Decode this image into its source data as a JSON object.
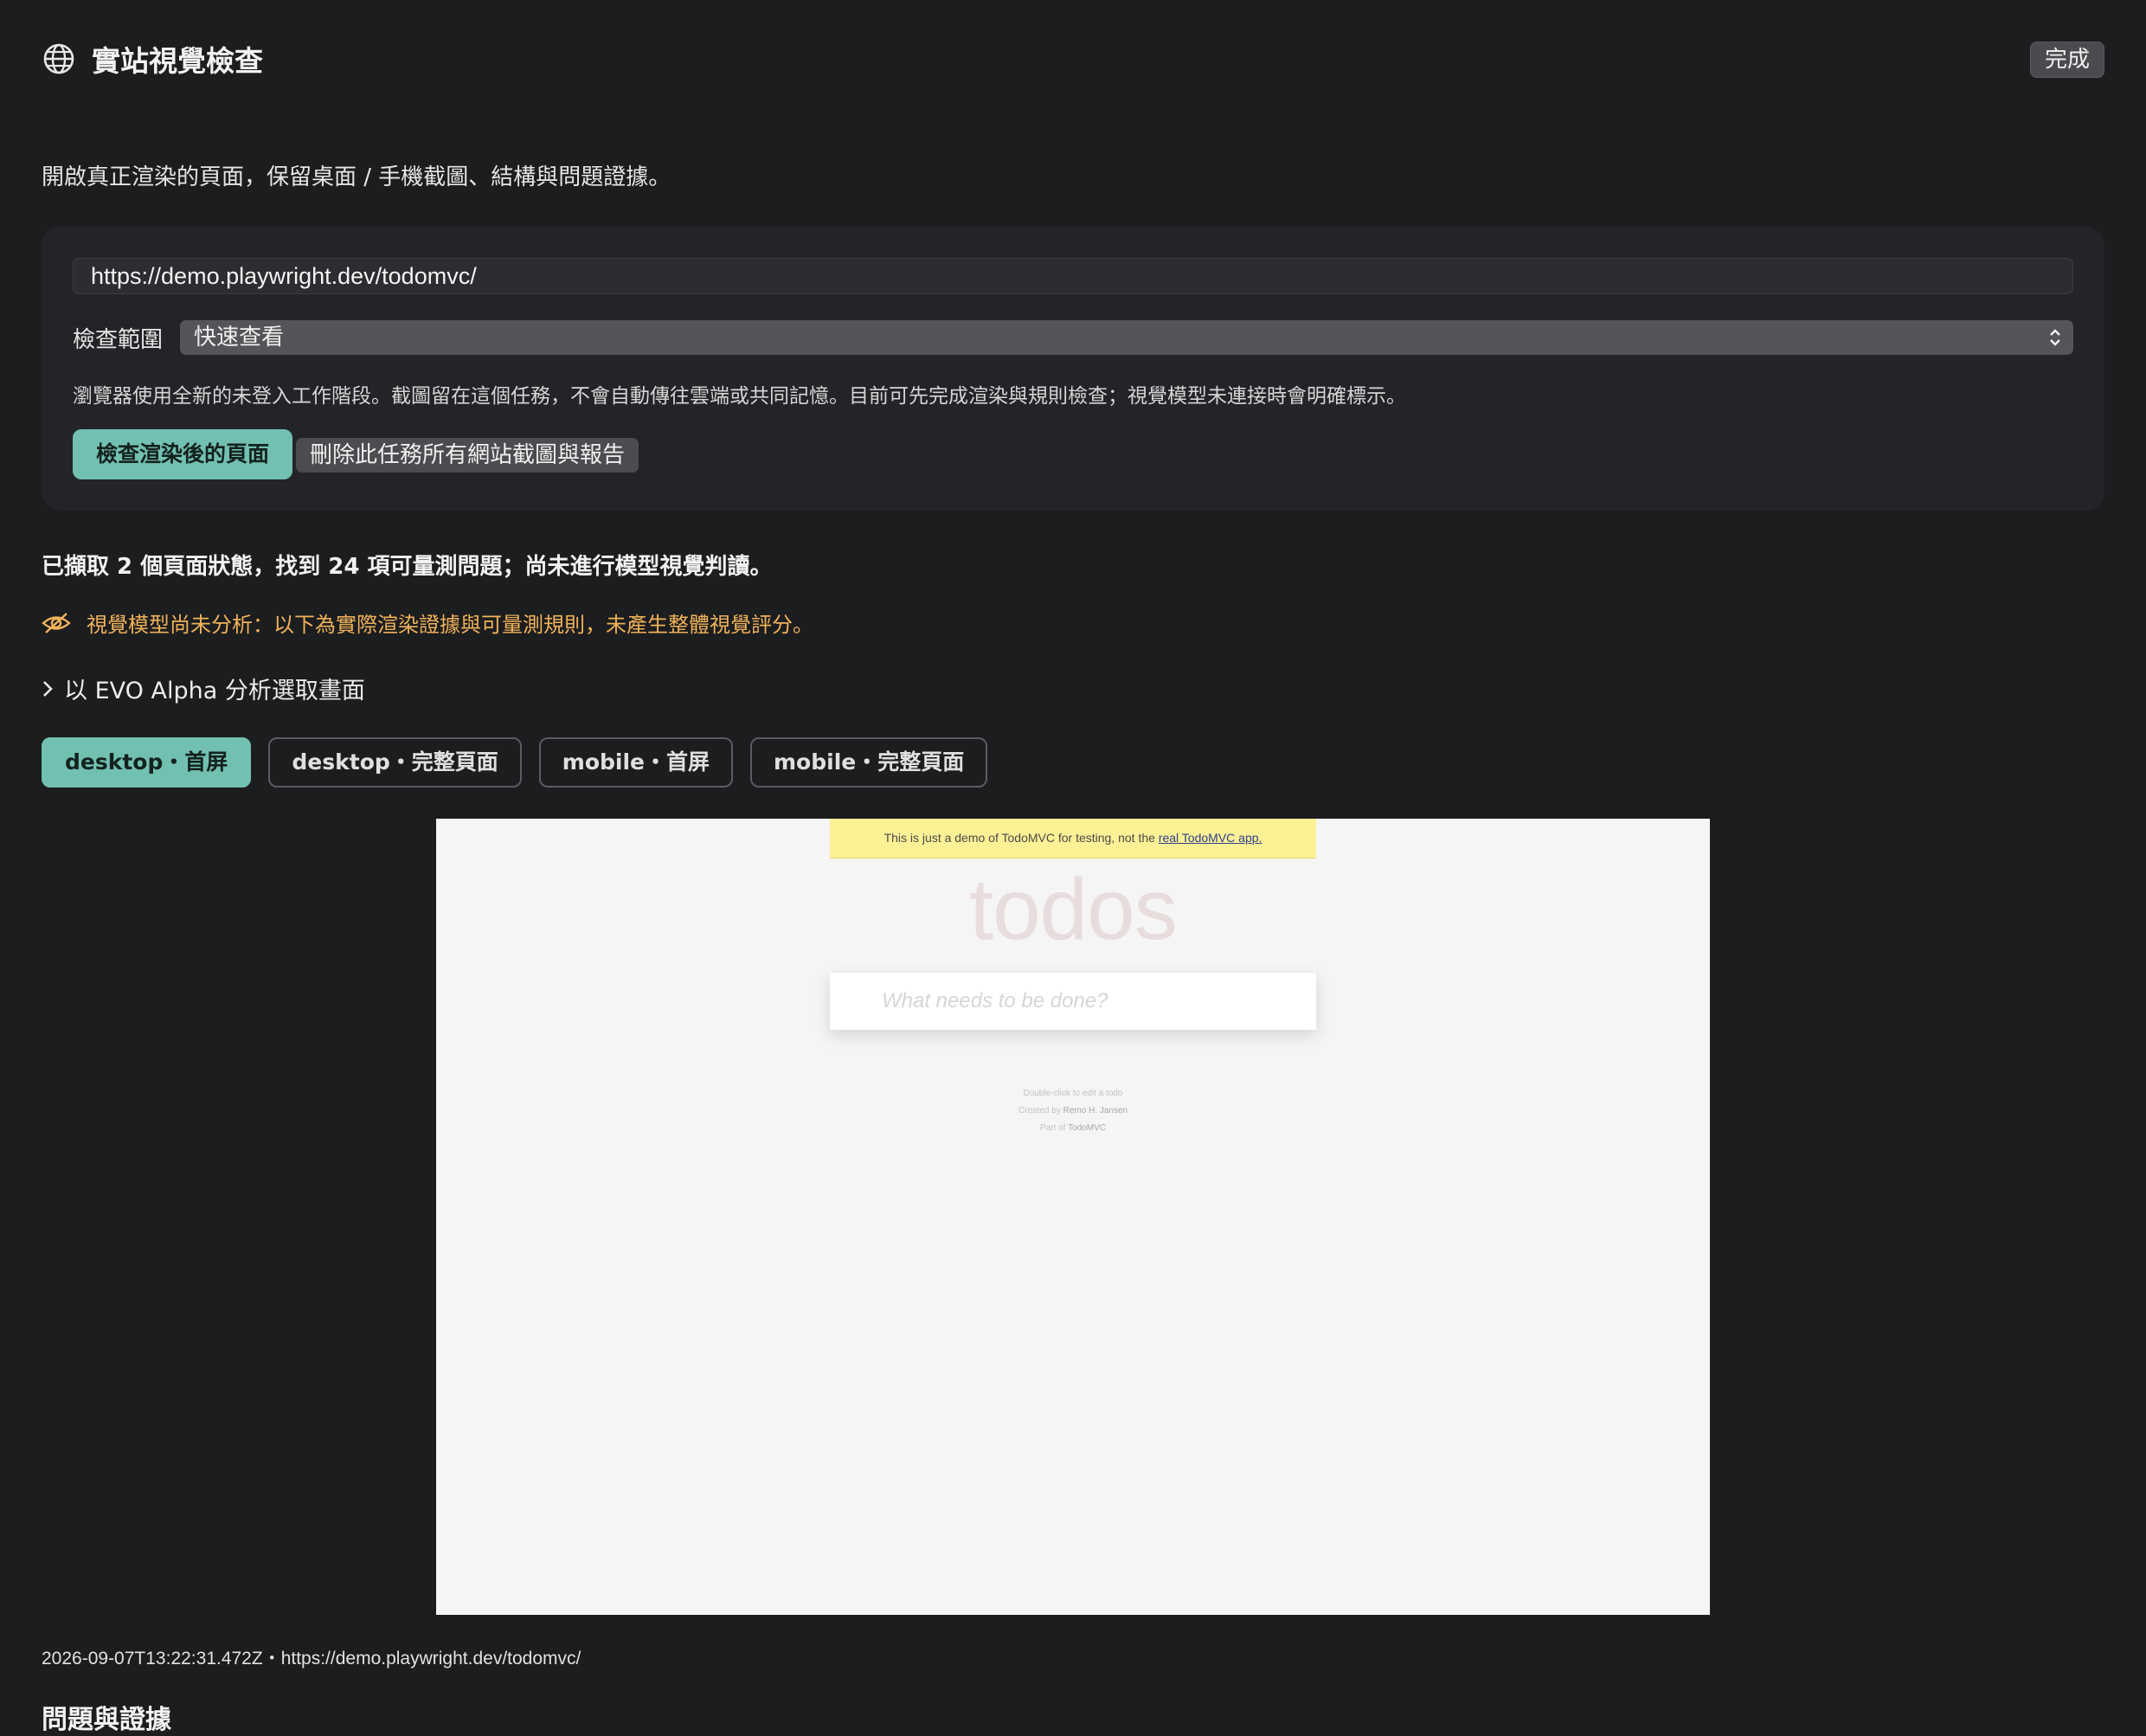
{
  "header": {
    "icon": "globe-icon",
    "title": "實站視覺檢查",
    "done_label": "完成"
  },
  "intro": "開啟真正渲染的頁面，保留桌面 / 手機截圖、結構與問題證據。",
  "form": {
    "url_value": "https://demo.playwright.dev/todomvc/",
    "scope_label": "檢查範圍",
    "scope_value": "快速查看",
    "note": "瀏覽器使用全新的未登入工作階段。截圖留在這個任務，不會自動傳往雲端或共同記憶。目前可先完成渲染與規則檢查；視覺模型未連接時會明確標示。",
    "inspect_button": "檢查渲染後的頁面",
    "delete_button": "刪除此任務所有網站截圖與報告"
  },
  "summary": "已擷取 2 個頁面狀態，找到 24 項可量測問題；尚未進行模型視覺判讀。",
  "warning": {
    "icon": "eye-slash-icon",
    "text": "視覺模型尚未分析：以下為實際渲染證據與可量測規則，未產生整體視覺評分。",
    "color": "#f0b25a"
  },
  "expander": {
    "icon": "chevron-right-icon",
    "label": "以 EVO Alpha 分析選取畫面"
  },
  "tabs": [
    {
      "label": "desktop・首屏",
      "active": true
    },
    {
      "label": "desktop・完整頁面",
      "active": false
    },
    {
      "label": "mobile・首屏",
      "active": false
    },
    {
      "label": "mobile・完整頁面",
      "active": false
    }
  ],
  "preview": {
    "banner_text": "This is just a demo of TodoMVC for testing, not the",
    "banner_link": "real TodoMVC app.",
    "app_title": "todos",
    "input_placeholder": "What needs to be done?",
    "info_line1": "Double-click to edit a todo",
    "info_line2_prefix": "Created by",
    "info_line2_name": "Remo H. Jansen",
    "info_line3_prefix": "Part of",
    "info_line3_name": "TodoMVC"
  },
  "meta": "2026-09-07T13:22:31.472Z・https://demo.playwright.dev/todomvc/",
  "section_title": "問題與證據",
  "colors": {
    "accent": "#72c0b1",
    "background": "#1c1d1f",
    "panel": "#232427"
  }
}
